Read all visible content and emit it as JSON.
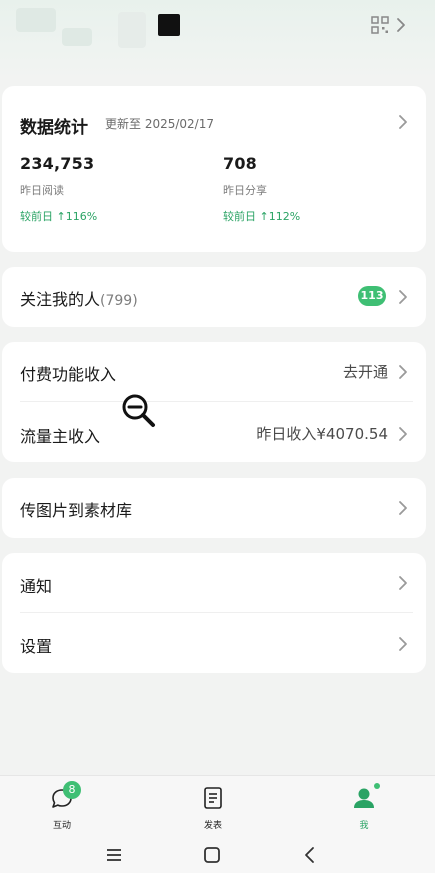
{
  "colors": {
    "accent": "#3fbf74",
    "positive": "#2aa364",
    "background": "#f2f3f2"
  },
  "header": {
    "qr_icon": "qr-code-icon",
    "chevron": "chevron-right-icon"
  },
  "stats": {
    "title": "数据统计",
    "updated": "更新至 2025/02/17",
    "items": [
      {
        "value": "234,753",
        "label": "昨日阅读",
        "change": "较前日 ↑116%"
      },
      {
        "value": "708",
        "label": "昨日分享",
        "change": "较前日 ↑112%"
      }
    ]
  },
  "followers": {
    "label": "关注我的人",
    "count": "(799)",
    "badge": "113"
  },
  "income": {
    "paid_label": "付费功能收入",
    "paid_value": "去开通",
    "traffic_label": "流量主收入",
    "traffic_value": "昨日收入¥4070.54"
  },
  "upload": {
    "label": "传图片到素材库"
  },
  "settings": {
    "notify_label": "通知",
    "settings_label": "设置"
  },
  "tabbar": {
    "tabs": [
      {
        "label": "互动",
        "icon": "chat-bubble-icon",
        "badge": "8"
      },
      {
        "label": "发表",
        "icon": "document-icon"
      },
      {
        "label": "我",
        "icon": "person-icon",
        "active": true
      }
    ]
  },
  "system_nav": {
    "icons": [
      "menu-icon",
      "home-icon",
      "back-icon"
    ]
  }
}
